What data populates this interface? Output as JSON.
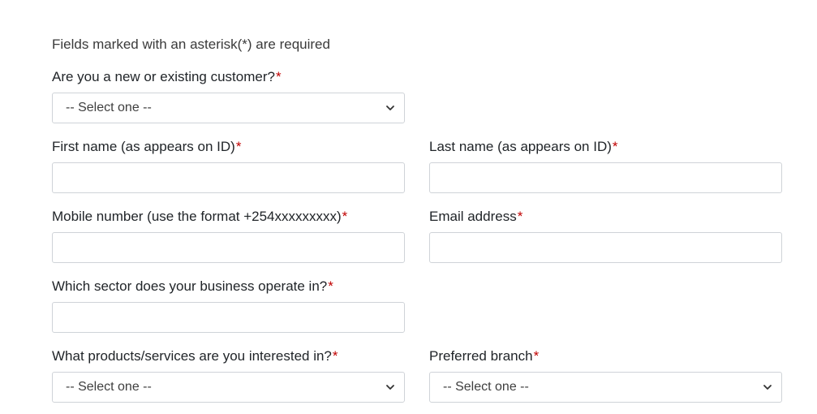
{
  "form": {
    "required_note": "Fields marked with an asterisk(*) are required",
    "asterisk": "*",
    "customer_type": {
      "label": "Are you a new or existing customer?",
      "selected": "-- Select one --"
    },
    "first_name": {
      "label": "First name (as appears on ID)",
      "value": ""
    },
    "last_name": {
      "label": "Last name (as appears on ID)",
      "value": ""
    },
    "mobile": {
      "label": "Mobile number (use the format +254xxxxxxxxx)",
      "value": ""
    },
    "email": {
      "label": "Email address",
      "value": ""
    },
    "sector": {
      "label": "Which sector does your business operate in?",
      "value": ""
    },
    "products": {
      "label": "What products/services are you interested in?",
      "selected": "-- Select one --"
    },
    "branch": {
      "label": "Preferred branch",
      "selected": "-- Select one --"
    }
  },
  "colors": {
    "text": "#212529",
    "asterisk": "#c00000",
    "border": "#cfd3d8"
  },
  "icons": {
    "dropdown": "chevron-down-icon"
  }
}
